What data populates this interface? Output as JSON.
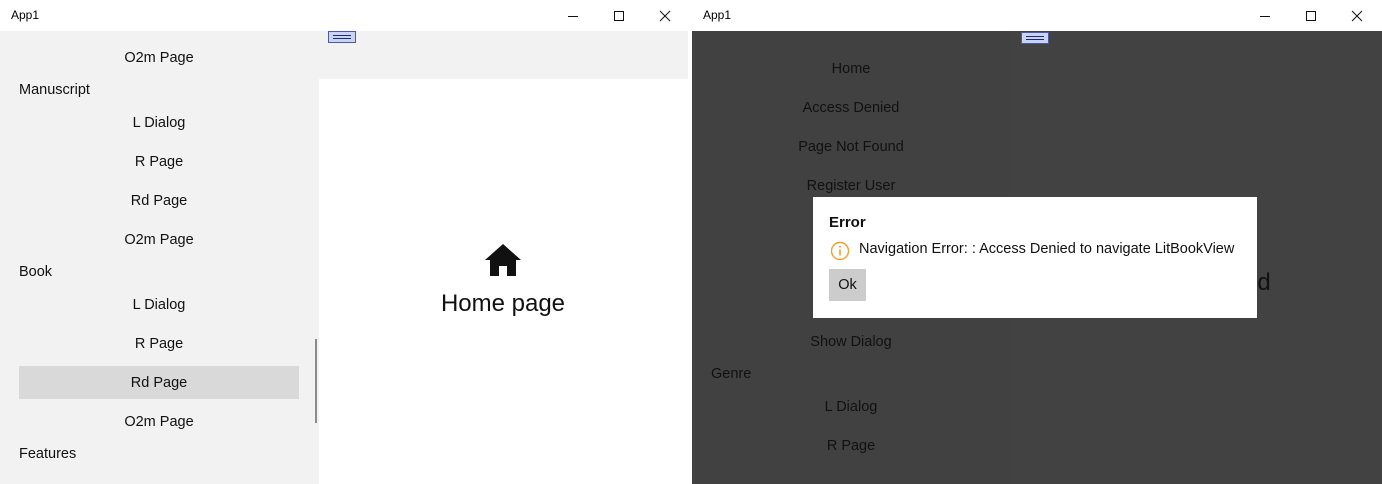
{
  "window1": {
    "title": "App1",
    "nav": {
      "items": [
        {
          "type": "item",
          "label": "O2m Page"
        },
        {
          "type": "header",
          "label": "Manuscript"
        },
        {
          "type": "item",
          "label": "L Dialog"
        },
        {
          "type": "item",
          "label": "R Page"
        },
        {
          "type": "item",
          "label": "Rd Page"
        },
        {
          "type": "item",
          "label": "O2m Page"
        },
        {
          "type": "header",
          "label": "Book"
        },
        {
          "type": "item",
          "label": "L Dialog"
        },
        {
          "type": "item",
          "label": "R Page"
        },
        {
          "type": "item",
          "label": "Rd Page",
          "selected": true
        },
        {
          "type": "item",
          "label": "O2m Page"
        },
        {
          "type": "header",
          "label": "Features"
        }
      ]
    },
    "main": {
      "icon": "home-icon",
      "label": "Home page"
    }
  },
  "window2": {
    "title": "App1",
    "nav": {
      "items": [
        {
          "type": "item",
          "label": "Home"
        },
        {
          "type": "item",
          "label": "Access Denied"
        },
        {
          "type": "item",
          "label": "Page Not Found"
        },
        {
          "type": "item",
          "label": "Register User"
        },
        {
          "type": "item",
          "label": "Show Dialog"
        },
        {
          "type": "header",
          "label": "Genre"
        },
        {
          "type": "item",
          "label": "L Dialog"
        },
        {
          "type": "item",
          "label": "R Page"
        }
      ]
    },
    "main": {
      "label_fragment": "nd"
    },
    "dialog": {
      "title": "Error",
      "icon": "info-icon",
      "message": "Navigation Error: : Access Denied to navigate LitBookView",
      "ok_label": "Ok",
      "accent": "#f0a030"
    }
  }
}
